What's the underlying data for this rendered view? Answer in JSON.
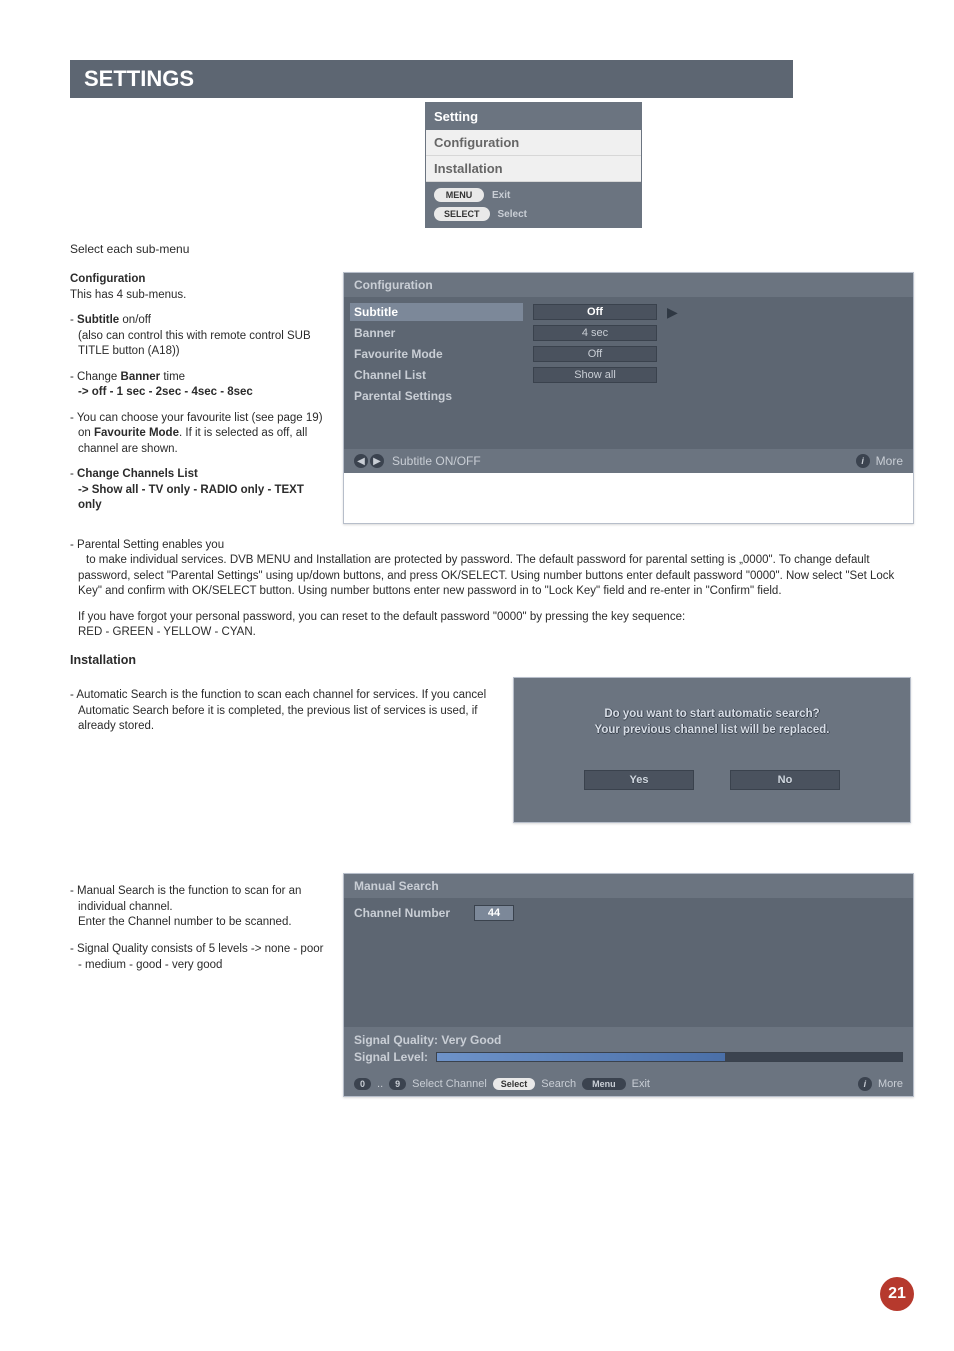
{
  "page_title": "SETTINGS",
  "intro_text": "Select each sub-menu",
  "setting_box": {
    "title": "Setting",
    "items": [
      "Configuration",
      "Installation"
    ],
    "hints": [
      {
        "pill": "MENU",
        "label": "Exit"
      },
      {
        "pill": "SELECT",
        "label": "Select"
      }
    ]
  },
  "config_left": {
    "heading": "Configuration",
    "sub": "This has 4 sub-menus.",
    "p1_a": "- ",
    "p1_b": "Subtitle",
    "p1_c": " on/off",
    "p1_d": "(also can control this with remote control SUB TITLE button (A18))",
    "p2_a": "- Change ",
    "p2_b": "Banner",
    "p2_c": " time",
    "p2_d": "-> off - 1 sec - 2sec - 4sec - 8sec",
    "p3_a": "- You can choose your favourite list (see page 19) on ",
    "p3_b": "Favourite Mode",
    "p3_c": ". If it is selected as off, all channel are shown.",
    "p4_a": "- ",
    "p4_b": "Change Channels List",
    "p4_c": "-> Show all - TV only - RADIO only - TEXT only"
  },
  "config_panel": {
    "header": "Configuration",
    "rows": [
      {
        "label": "Subtitle",
        "value": "Off",
        "selected": true,
        "arrow": true
      },
      {
        "label": "Banner",
        "value": "4 sec",
        "selected": false,
        "arrow": false
      },
      {
        "label": "Favourite Mode",
        "value": "Off",
        "selected": false,
        "arrow": false
      },
      {
        "label": "Channel List",
        "value": "Show all",
        "selected": false,
        "arrow": false
      },
      {
        "label": "Parental Settings",
        "value": "",
        "selected": false,
        "arrow": false
      }
    ],
    "footer_left": "Subtitle ON/OFF",
    "footer_right": "More",
    "footer_icon": "i"
  },
  "parental_block": {
    "p1_a": "- ",
    "p1_b": "Parental Setting",
    "p1_c": " enables you",
    "p2_a": "to make individual services. ",
    "p2_b": "DVB MENU",
    "p2_c": " and Installation are protected by password. The default password for ",
    "p2_d": "parental setting",
    "p2_e": " is „0000\". To change default password, select \"Parental Settings\" using up/down buttons, and press OK/SELECT. Using number buttons enter default password \"0000\". Now select \"Set Lock Key\" and confirm with OK/SELECT button. Using number buttons enter new password in to \"Lock Key\" field and re-enter in \"Confirm\" field.",
    "p3_a": "If you have forgot your personal password,  you can reset to the default password \"0000\" by pressing the key sequence:",
    "p3_b": "RED - GREEN - YELLOW - CYAN",
    "p3_c": "."
  },
  "installation": {
    "heading": "Installation",
    "auto_a": "- ",
    "auto_b": "Automatic Search",
    "auto_c": " is the function to scan each channel for services. If you cancel Automatic Search before it is completed, the previous list of services is used, if already stored.",
    "dialog_line1": "Do you want to start automatic search?",
    "dialog_line2": "Your previous channel list will be replaced.",
    "yes": "Yes",
    "no": "No"
  },
  "manual": {
    "p1_a": "- ",
    "p1_b": "Manual Search",
    "p1_c": " is the function to scan for an individual channel.",
    "p1_d": "Enter the ",
    "p1_e": "Channel number",
    "p1_f": " to be scanned.",
    "p2_a": "- Signal Quality consists of 5 levels ",
    "p2_b": "-> none - poor - medium - good - very good",
    "panel_header": "Manual Search",
    "chn_label": "Channel Number",
    "chn_value": "44",
    "sig_quality": "Signal Quality: Very Good",
    "sig_level": "Signal Level:",
    "footer": {
      "n0": "0",
      "dots": "..",
      "n9": "9",
      "sel_channel": "Select Channel",
      "select": "Select",
      "search": "Search",
      "menu": "Menu",
      "exit": "Exit",
      "i": "i",
      "more": "More"
    }
  },
  "page_number": "21"
}
